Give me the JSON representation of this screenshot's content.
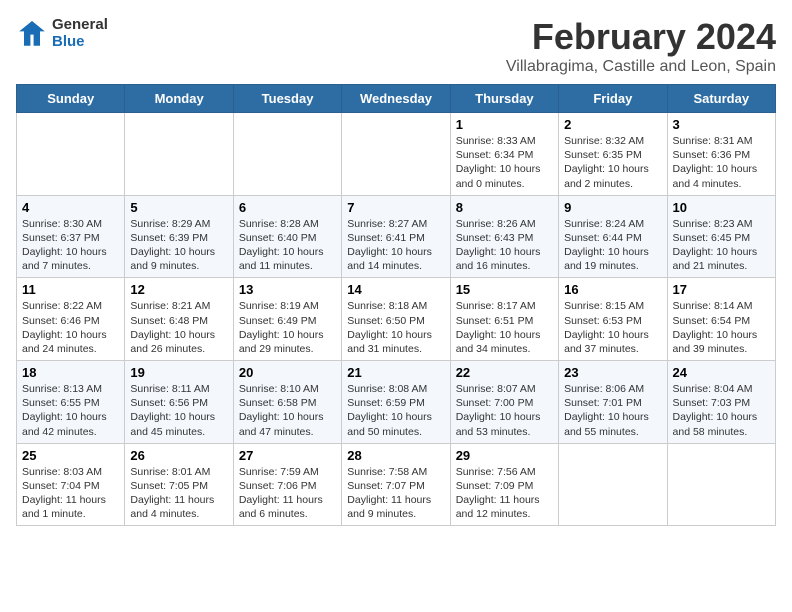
{
  "header": {
    "logo_line1": "General",
    "logo_line2": "Blue",
    "month": "February 2024",
    "location": "Villabragima, Castille and Leon, Spain"
  },
  "weekdays": [
    "Sunday",
    "Monday",
    "Tuesday",
    "Wednesday",
    "Thursday",
    "Friday",
    "Saturday"
  ],
  "weeks": [
    [
      {
        "day": "",
        "info": ""
      },
      {
        "day": "",
        "info": ""
      },
      {
        "day": "",
        "info": ""
      },
      {
        "day": "",
        "info": ""
      },
      {
        "day": "1",
        "info": "Sunrise: 8:33 AM\nSunset: 6:34 PM\nDaylight: 10 hours\nand 0 minutes."
      },
      {
        "day": "2",
        "info": "Sunrise: 8:32 AM\nSunset: 6:35 PM\nDaylight: 10 hours\nand 2 minutes."
      },
      {
        "day": "3",
        "info": "Sunrise: 8:31 AM\nSunset: 6:36 PM\nDaylight: 10 hours\nand 4 minutes."
      }
    ],
    [
      {
        "day": "4",
        "info": "Sunrise: 8:30 AM\nSunset: 6:37 PM\nDaylight: 10 hours\nand 7 minutes."
      },
      {
        "day": "5",
        "info": "Sunrise: 8:29 AM\nSunset: 6:39 PM\nDaylight: 10 hours\nand 9 minutes."
      },
      {
        "day": "6",
        "info": "Sunrise: 8:28 AM\nSunset: 6:40 PM\nDaylight: 10 hours\nand 11 minutes."
      },
      {
        "day": "7",
        "info": "Sunrise: 8:27 AM\nSunset: 6:41 PM\nDaylight: 10 hours\nand 14 minutes."
      },
      {
        "day": "8",
        "info": "Sunrise: 8:26 AM\nSunset: 6:43 PM\nDaylight: 10 hours\nand 16 minutes."
      },
      {
        "day": "9",
        "info": "Sunrise: 8:24 AM\nSunset: 6:44 PM\nDaylight: 10 hours\nand 19 minutes."
      },
      {
        "day": "10",
        "info": "Sunrise: 8:23 AM\nSunset: 6:45 PM\nDaylight: 10 hours\nand 21 minutes."
      }
    ],
    [
      {
        "day": "11",
        "info": "Sunrise: 8:22 AM\nSunset: 6:46 PM\nDaylight: 10 hours\nand 24 minutes."
      },
      {
        "day": "12",
        "info": "Sunrise: 8:21 AM\nSunset: 6:48 PM\nDaylight: 10 hours\nand 26 minutes."
      },
      {
        "day": "13",
        "info": "Sunrise: 8:19 AM\nSunset: 6:49 PM\nDaylight: 10 hours\nand 29 minutes."
      },
      {
        "day": "14",
        "info": "Sunrise: 8:18 AM\nSunset: 6:50 PM\nDaylight: 10 hours\nand 31 minutes."
      },
      {
        "day": "15",
        "info": "Sunrise: 8:17 AM\nSunset: 6:51 PM\nDaylight: 10 hours\nand 34 minutes."
      },
      {
        "day": "16",
        "info": "Sunrise: 8:15 AM\nSunset: 6:53 PM\nDaylight: 10 hours\nand 37 minutes."
      },
      {
        "day": "17",
        "info": "Sunrise: 8:14 AM\nSunset: 6:54 PM\nDaylight: 10 hours\nand 39 minutes."
      }
    ],
    [
      {
        "day": "18",
        "info": "Sunrise: 8:13 AM\nSunset: 6:55 PM\nDaylight: 10 hours\nand 42 minutes."
      },
      {
        "day": "19",
        "info": "Sunrise: 8:11 AM\nSunset: 6:56 PM\nDaylight: 10 hours\nand 45 minutes."
      },
      {
        "day": "20",
        "info": "Sunrise: 8:10 AM\nSunset: 6:58 PM\nDaylight: 10 hours\nand 47 minutes."
      },
      {
        "day": "21",
        "info": "Sunrise: 8:08 AM\nSunset: 6:59 PM\nDaylight: 10 hours\nand 50 minutes."
      },
      {
        "day": "22",
        "info": "Sunrise: 8:07 AM\nSunset: 7:00 PM\nDaylight: 10 hours\nand 53 minutes."
      },
      {
        "day": "23",
        "info": "Sunrise: 8:06 AM\nSunset: 7:01 PM\nDaylight: 10 hours\nand 55 minutes."
      },
      {
        "day": "24",
        "info": "Sunrise: 8:04 AM\nSunset: 7:03 PM\nDaylight: 10 hours\nand 58 minutes."
      }
    ],
    [
      {
        "day": "25",
        "info": "Sunrise: 8:03 AM\nSunset: 7:04 PM\nDaylight: 11 hours\nand 1 minute."
      },
      {
        "day": "26",
        "info": "Sunrise: 8:01 AM\nSunset: 7:05 PM\nDaylight: 11 hours\nand 4 minutes."
      },
      {
        "day": "27",
        "info": "Sunrise: 7:59 AM\nSunset: 7:06 PM\nDaylight: 11 hours\nand 6 minutes."
      },
      {
        "day": "28",
        "info": "Sunrise: 7:58 AM\nSunset: 7:07 PM\nDaylight: 11 hours\nand 9 minutes."
      },
      {
        "day": "29",
        "info": "Sunrise: 7:56 AM\nSunset: 7:09 PM\nDaylight: 11 hours\nand 12 minutes."
      },
      {
        "day": "",
        "info": ""
      },
      {
        "day": "",
        "info": ""
      }
    ]
  ]
}
